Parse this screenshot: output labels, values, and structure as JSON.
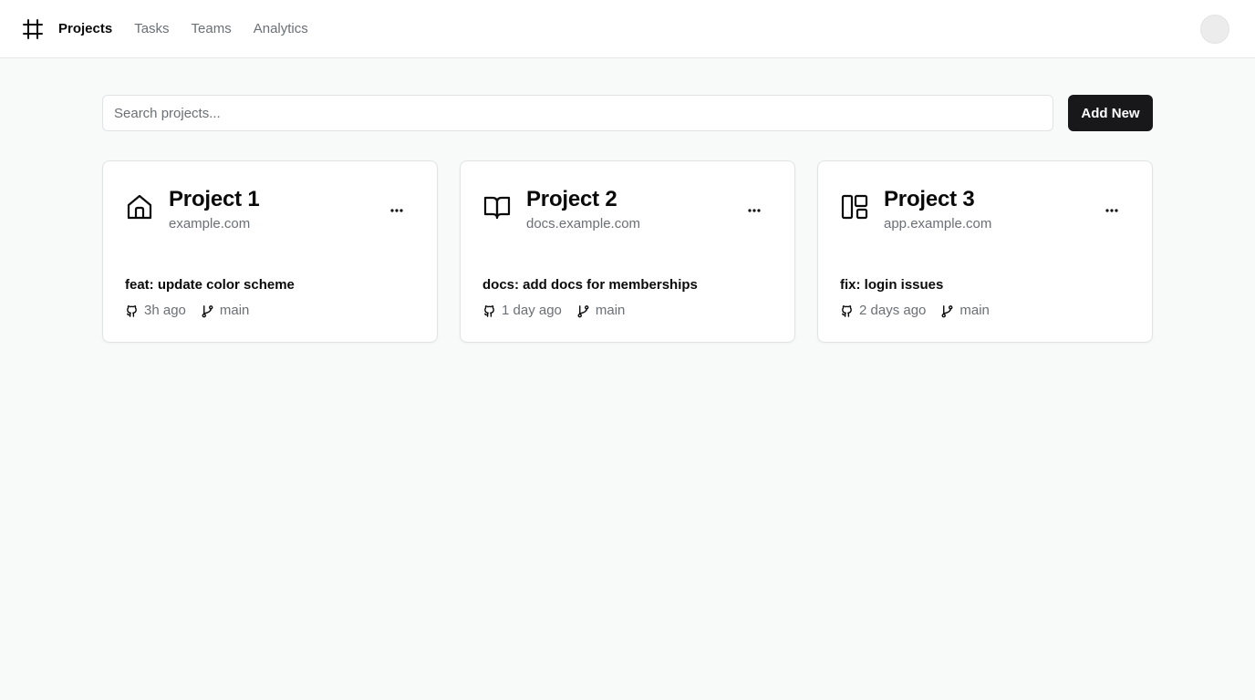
{
  "header": {
    "logo_icon": "hash-frame-icon",
    "nav": [
      {
        "label": "Projects",
        "active": true
      },
      {
        "label": "Tasks",
        "active": false
      },
      {
        "label": "Teams",
        "active": false
      },
      {
        "label": "Analytics",
        "active": false
      }
    ],
    "avatar_icon": "avatar"
  },
  "search": {
    "placeholder": "Search projects...",
    "value": ""
  },
  "toolbar": {
    "add_label": "Add New"
  },
  "projects": [
    {
      "icon": "home-icon",
      "title": "Project 1",
      "domain": "example.com",
      "commit": "feat: update color scheme",
      "time": "3h ago",
      "branch": "main"
    },
    {
      "icon": "book-open-icon",
      "title": "Project 2",
      "domain": "docs.example.com",
      "commit": "docs: add docs for memberships",
      "time": "1 day ago",
      "branch": "main"
    },
    {
      "icon": "layout-panels-icon",
      "title": "Project 3",
      "domain": "app.example.com",
      "commit": "fix: login issues",
      "time": "2 days ago",
      "branch": "main"
    }
  ],
  "colors": {
    "background": "#f8f9f9",
    "card": "#ffffff",
    "border": "#e2e3e5",
    "muted_text": "#6b6f76",
    "primary_button": "#18181b"
  }
}
